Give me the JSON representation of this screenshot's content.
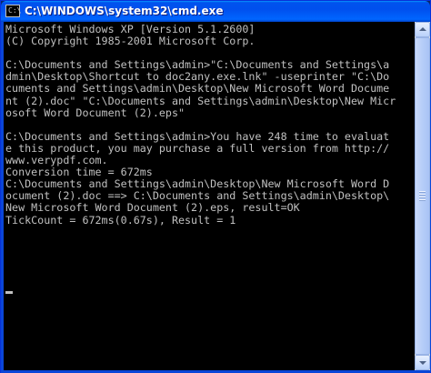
{
  "window": {
    "title": "C:\\WINDOWS\\system32\\cmd.exe",
    "icon": "console-icon"
  },
  "console": {
    "lines": [
      "Microsoft Windows XP [Version 5.1.2600]",
      "(C) Copyright 1985-2001 Microsoft Corp.",
      "",
      "C:\\Documents and Settings\\admin>\"C:\\Documents and Settings\\a",
      "dmin\\Desktop\\Shortcut to doc2any.exe.lnk\" -useprinter \"C:\\Do",
      "cuments and Settings\\admin\\Desktop\\New Microsoft Word Docume",
      "nt (2).doc\" \"C:\\Documents and Settings\\admin\\Desktop\\New Micr",
      "osoft Word Document (2).eps\"",
      "",
      "C:\\Documents and Settings\\admin>You have 248 time to evaluat",
      "e this product, you may purchase a full version from http://",
      "www.verypdf.com.",
      "Conversion time = 672ms",
      "C:\\Documents and Settings\\admin\\Desktop\\New Microsoft Word D",
      "ocument (2).doc ==> C:\\Documents and Settings\\admin\\Desktop\\",
      "New Microsoft Word Document (2).eps, result=OK",
      "TickCount = 672ms(0.67s), Result = 1",
      ""
    ]
  },
  "colors": {
    "console_bg": "#000000",
    "console_fg": "#c0c0c0",
    "titlebar": "#0053ee"
  }
}
